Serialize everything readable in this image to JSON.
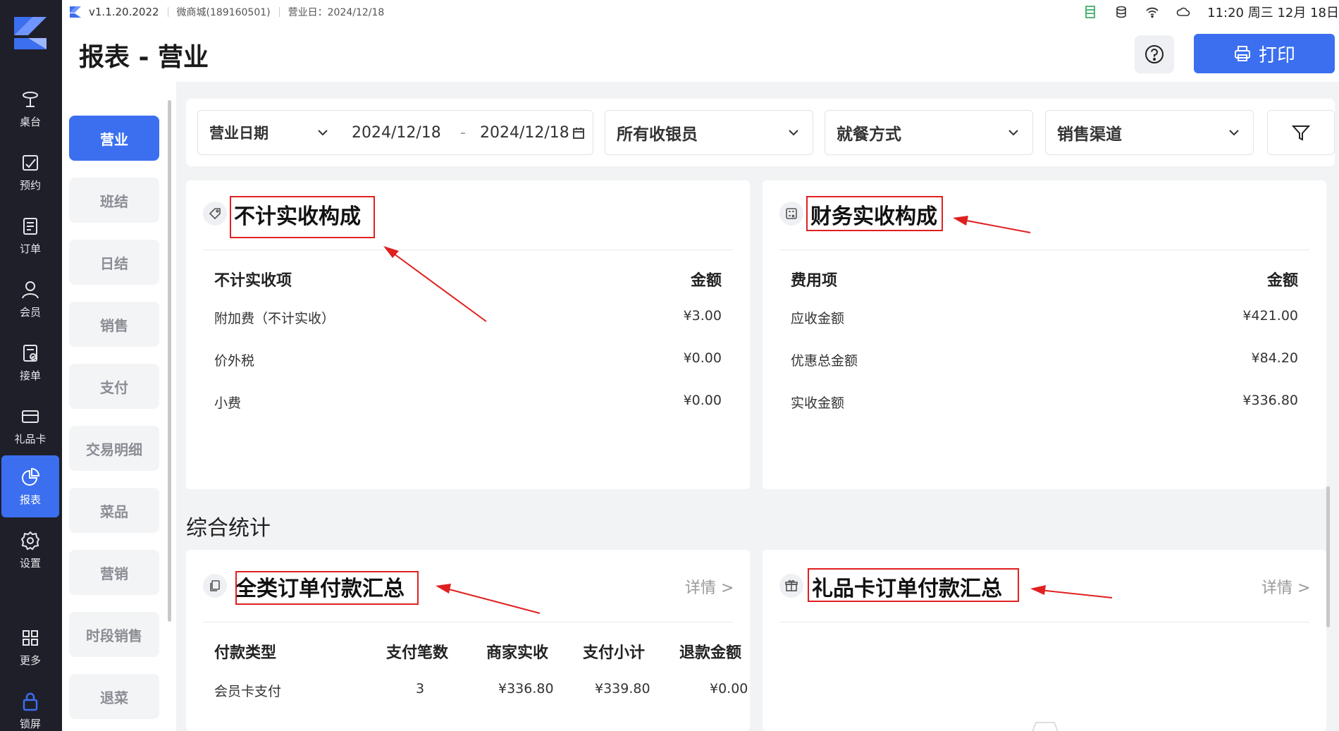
{
  "status_bar": {
    "version": "v1.1.20.2022",
    "store": "微商城(189160501)",
    "business_day": "营业日：2024/12/18",
    "time": "11:20 周三 12月 18日"
  },
  "nav": {
    "items": [
      {
        "label": "桌台",
        "icon": "table-icon"
      },
      {
        "label": "预约",
        "icon": "reservation-icon"
      },
      {
        "label": "订单",
        "icon": "order-icon"
      },
      {
        "label": "会员",
        "icon": "member-icon"
      },
      {
        "label": "接单",
        "icon": "accept-order-icon"
      },
      {
        "label": "礼品卡",
        "icon": "gift-card-icon"
      },
      {
        "label": "报表",
        "icon": "report-icon",
        "active": true
      },
      {
        "label": "设置",
        "icon": "settings-icon"
      },
      {
        "label": "更多",
        "icon": "more-icon"
      },
      {
        "label": "锁屏",
        "icon": "lock-icon"
      }
    ]
  },
  "header": {
    "title": "报表 - 营业",
    "print_label": "打印"
  },
  "subnav": {
    "items": [
      "营业",
      "班结",
      "日结",
      "销售",
      "支付",
      "交易明细",
      "菜品",
      "营销",
      "时段销售",
      "退菜"
    ]
  },
  "filters": {
    "date_type": "营业日期",
    "date_start": "2024/12/18",
    "date_sep": "-",
    "date_end": "2024/12/18",
    "cashier": "所有收银员",
    "dining_mode": "就餐方式",
    "sales_channel": "销售渠道"
  },
  "non_revenue": {
    "title": "不计实收构成",
    "col_item": "不计实收项",
    "col_amount": "金额",
    "rows": [
      {
        "name": "附加费（不计实收）",
        "amount": "¥3.00"
      },
      {
        "name": "价外税",
        "amount": "¥0.00"
      },
      {
        "name": "小费",
        "amount": "¥0.00"
      }
    ]
  },
  "finance": {
    "title": "财务实收构成",
    "col_item": "费用项",
    "col_amount": "金额",
    "rows": [
      {
        "name": "应收金额",
        "amount": "¥421.00"
      },
      {
        "name": "优惠总金额",
        "amount": "¥84.20"
      },
      {
        "name": "实收金额",
        "amount": "¥336.80"
      }
    ]
  },
  "summary": {
    "section_title": "综合统计",
    "all_orders": {
      "title": "全类订单付款汇总",
      "detail": "详情 >",
      "columns": [
        "付款类型",
        "支付笔数",
        "商家实收",
        "支付小计",
        "退款金额"
      ],
      "rows": [
        [
          "会员卡支付",
          "3",
          "¥336.80",
          "¥339.80",
          "¥0.00"
        ]
      ]
    },
    "gift_card_orders": {
      "title": "礼品卡订单付款汇总",
      "detail": "详情 >"
    }
  }
}
